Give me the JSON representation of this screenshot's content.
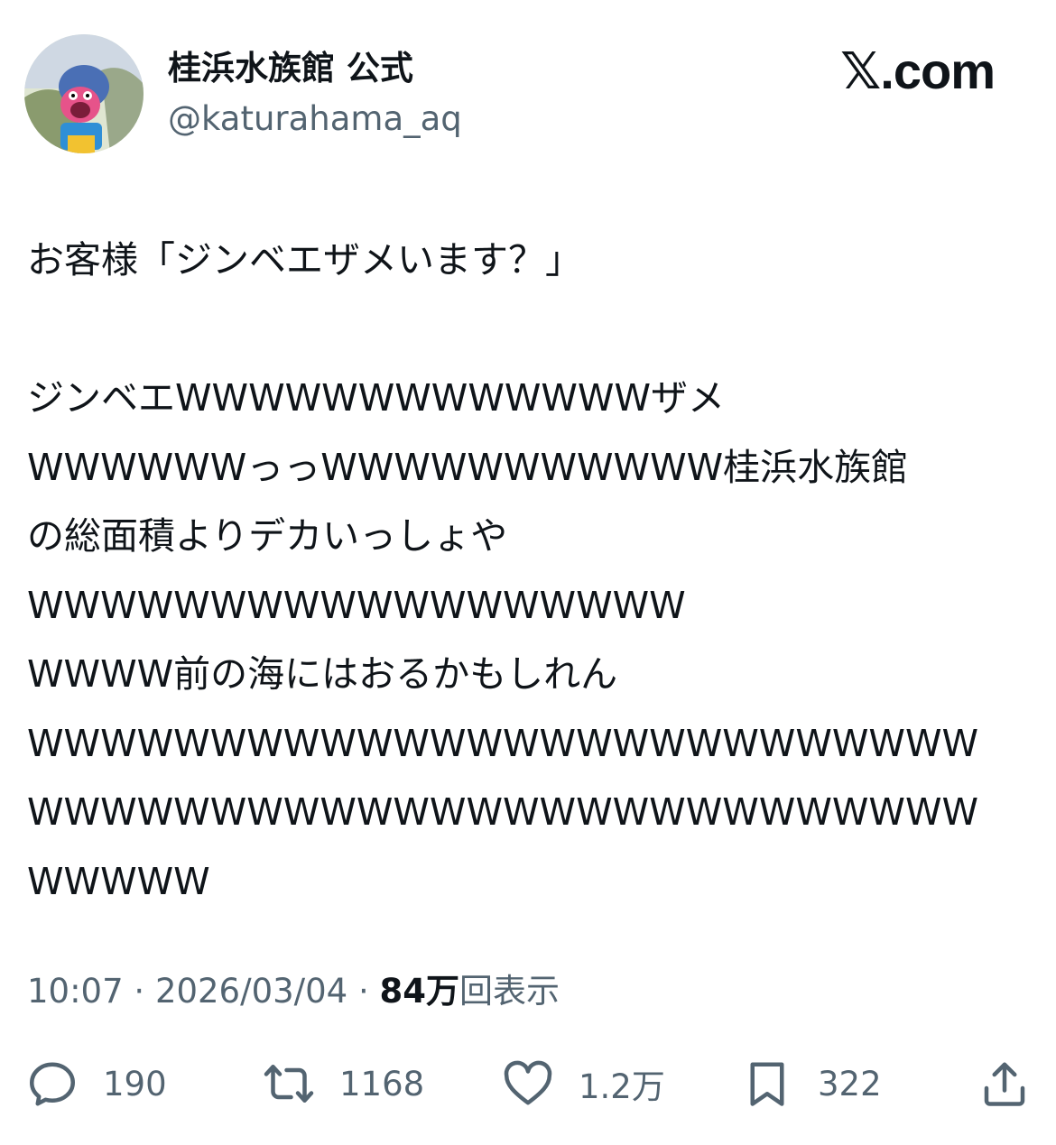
{
  "header": {
    "display_name": "桂浜水族館 公式",
    "handle": "@katurahama_aq",
    "brand": "𝕏.com"
  },
  "tweet": {
    "lines": [
      "お客様「ジンベエザメいます？」",
      "",
      "ジンベエWWWWWWWWWWWWWザメ",
      "WWWWWWっっWWWWWWWWWWW桂浜水族館",
      "の総面積よりデカいっしょや",
      "WWWWWWWWWWWWWWWWWW",
      "WWWW前の海にはおるかもしれん",
      "WWWWWWWWWWWWWWWWWWWWWWWWWW",
      "WWWWWWWWWWWWWWWWWWWWWWWWWW",
      "WWWWW"
    ]
  },
  "meta": {
    "time": "10:07",
    "date": "2026/03/04",
    "separator": "·",
    "views_count": "84万",
    "views_label": "回表示"
  },
  "actions": {
    "reply": {
      "icon": "reply-icon",
      "count": "190"
    },
    "retweet": {
      "icon": "retweet-icon",
      "count": "1168"
    },
    "like": {
      "icon": "heart-icon",
      "count": "1.2万"
    },
    "bookmark": {
      "icon": "bookmark-icon",
      "count": "322"
    },
    "share": {
      "icon": "share-icon"
    }
  },
  "colors": {
    "text": "#0f1419",
    "secondary": "#536471",
    "background": "#ffffff"
  }
}
